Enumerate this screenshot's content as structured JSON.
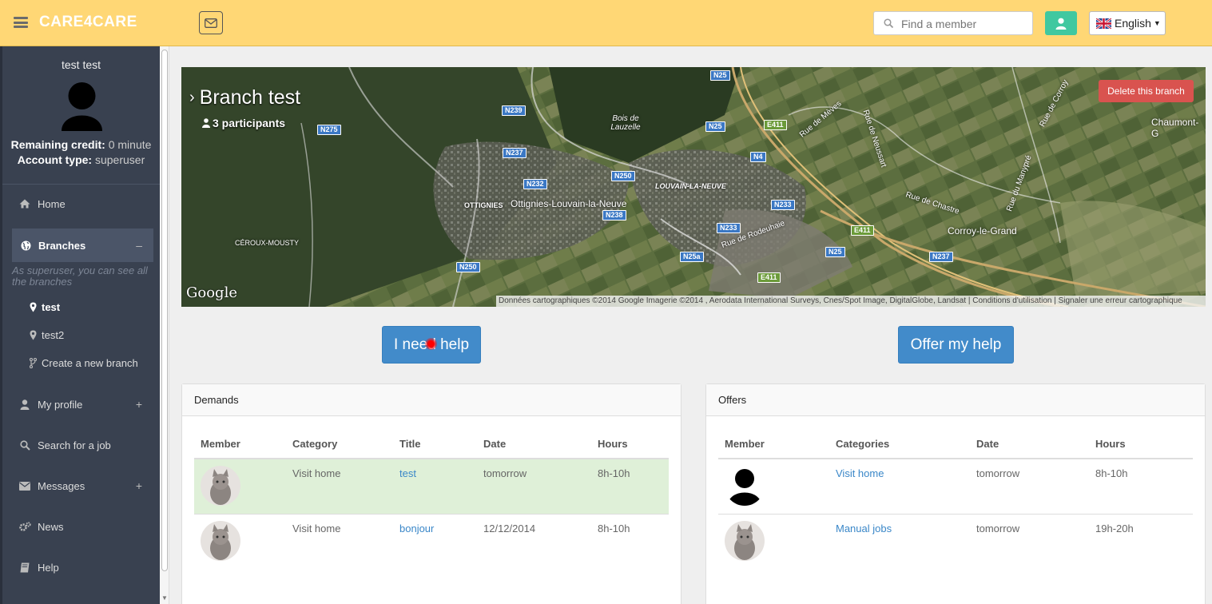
{
  "header": {
    "brand": "CARE4CARE",
    "search_placeholder": "Find a member",
    "language": "English"
  },
  "sidebar": {
    "user_name": "test test",
    "remaining_credit_label": "Remaining credit:",
    "remaining_credit_value": "0 minute",
    "account_type_label": "Account type:",
    "account_type_value": "superuser",
    "nav": {
      "home": "Home",
      "branches": "Branches",
      "branches_toggle": "–",
      "superuser_note": "As superuser, you can see all the branches",
      "branch_1": "test",
      "branch_2": "test2",
      "create_branch": "Create a new branch",
      "my_profile": "My profile",
      "search_job": "Search for a job",
      "messages": "Messages",
      "news": "News",
      "help": "Help",
      "plus": "+"
    }
  },
  "banner": {
    "title": "Branch test",
    "participants": "3 participants",
    "delete_label": "Delete this branch",
    "google": "Google",
    "attribution": "Données cartographiques ©2014 Google Imagerie ©2014 , Aerodata International Surveys, Cnes/Spot Image, DigitalGlobe, Landsat  |  Conditions d'utilisation  |  Signaler une erreur cartographique",
    "places": {
      "ottignies": "Ottignies-Louvain-la-Neuve",
      "ottignies_caps": "OTTIGNIES",
      "lln_caps": "LOUVAIN-LA-NEUVE",
      "ceroux": "CÉROUX-MOUSTY",
      "corroy": "Corroy-le-Grand",
      "chaumont": "Chaumont-G",
      "bois": "Bois de Lauzelle",
      "rue_meves": "Rue de Mèves",
      "rue_neussart": "Rue de Neussart",
      "rue_chastre": "Rue de Chastre",
      "rue_rodeuhaie": "Rue de Rodeuhaie",
      "rue_manypre": "Rue du Manypré",
      "rue_corroy": "Rue de Corroy"
    },
    "roads": [
      "N25",
      "N239",
      "N275",
      "N237",
      "N232",
      "N250",
      "N238",
      "N25",
      "N4",
      "N233",
      "N233",
      "N25a",
      "N25",
      "E411",
      "E411",
      "E411",
      "N237",
      "N250"
    ]
  },
  "actions": {
    "need_help": "I need help",
    "offer_help": "Offer my help"
  },
  "demands": {
    "title": "Demands",
    "columns": [
      "Member",
      "Category",
      "Title",
      "Date",
      "Hours"
    ],
    "rows": [
      {
        "category": "Visit home",
        "title": "test",
        "date": "tomorrow",
        "hours": "8h-10h"
      },
      {
        "category": "Visit home",
        "title": "bonjour",
        "date": "12/12/2014",
        "hours": "8h-10h"
      }
    ]
  },
  "offers": {
    "title": "Offers",
    "columns": [
      "Member",
      "Categories",
      "Date",
      "Hours"
    ],
    "rows": [
      {
        "category": "Visit home",
        "date": "tomorrow",
        "hours": "8h-10h"
      },
      {
        "category": "Manual jobs",
        "date": "tomorrow",
        "hours": "19h-20h"
      }
    ]
  },
  "colors": {
    "topbar": "#ffd775",
    "sidebar": "#394150",
    "primary": "#428bca",
    "danger": "#d9534f",
    "accent": "#40c8a0",
    "row_highlight": "#dff0d8"
  }
}
